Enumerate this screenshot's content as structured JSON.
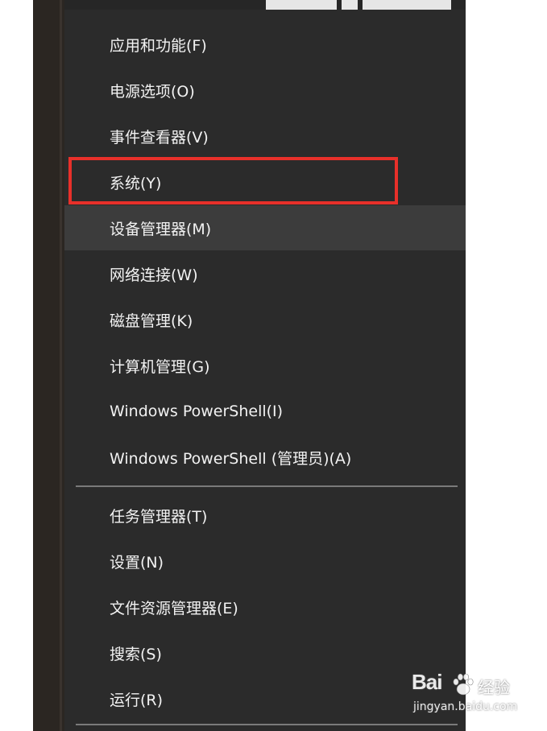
{
  "menu": {
    "items": [
      {
        "label": "应用和功能(F)"
      },
      {
        "label": "电源选项(O)"
      },
      {
        "label": "事件查看器(V)"
      },
      {
        "label": "系统(Y)"
      },
      {
        "label": "设备管理器(M)"
      },
      {
        "label": "网络连接(W)"
      },
      {
        "label": "磁盘管理(K)"
      },
      {
        "label": "计算机管理(G)"
      },
      {
        "label": "Windows PowerShell(I)"
      },
      {
        "label": "Windows PowerShell (管理员)(A)"
      },
      {
        "label": "任务管理器(T)"
      },
      {
        "label": "设置(N)"
      },
      {
        "label": "文件资源管理器(E)"
      },
      {
        "label": "搜索(S)"
      },
      {
        "label": "运行(R)"
      }
    ],
    "hovered_item": "设备管理器(M)",
    "annotated_item": "系统(Y)"
  },
  "colors": {
    "menu_background": "#2b2b2b",
    "hover_background": "#3c3c3c",
    "annotation_box": "#e8302a",
    "text": "#f2f2f2"
  },
  "watermark": {
    "brand": "Bai",
    "brand_suffix": "经验",
    "url": "jingyan.baidu.com",
    "icon": "baidu-paw-icon"
  }
}
